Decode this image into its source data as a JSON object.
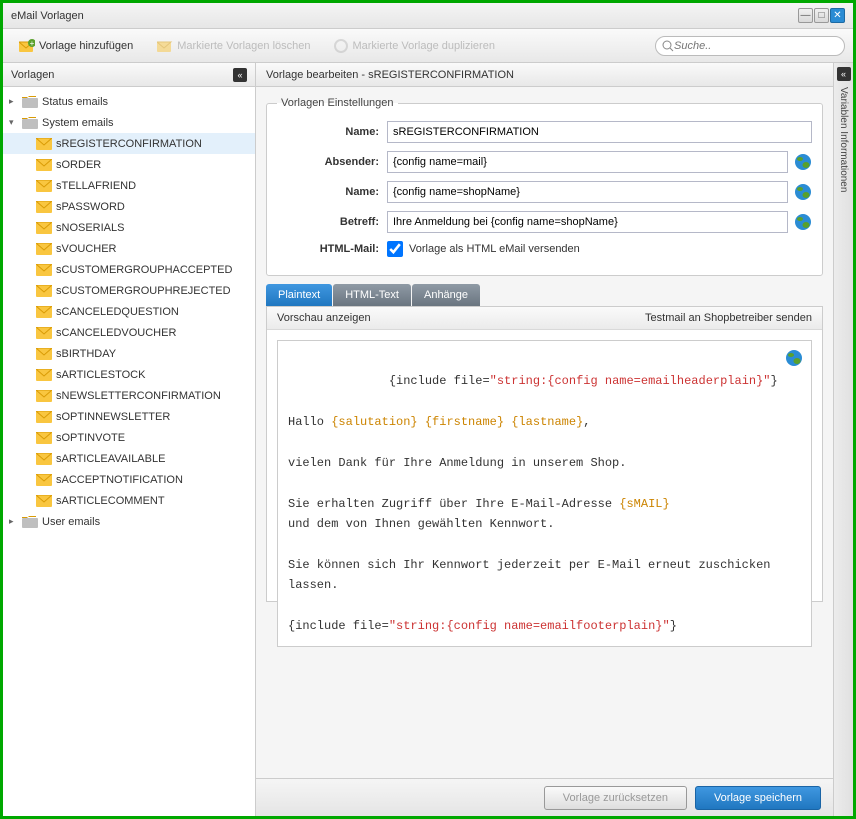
{
  "window": {
    "title": "eMail Vorlagen"
  },
  "toolbar": {
    "add": "Vorlage hinzufügen",
    "delete": "Markierte Vorlagen löschen",
    "duplicate": "Markierte Vorlage duplizieren",
    "search_placeholder": "Suche.."
  },
  "sidebar": {
    "title": "Vorlagen",
    "folders": [
      {
        "label": "Status emails",
        "expanded": false
      },
      {
        "label": "System emails",
        "expanded": true,
        "children": [
          "sREGISTERCONFIRMATION",
          "sORDER",
          "sTELLAFRIEND",
          "sPASSWORD",
          "sNOSERIALS",
          "sVOUCHER",
          "sCUSTOMERGROUPHACCEPTED",
          "sCUSTOMERGROUPHREJECTED",
          "sCANCELEDQUESTION",
          "sCANCELEDVOUCHER",
          "sBIRTHDAY",
          "sARTICLESTOCK",
          "sNEWSLETTERCONFIRMATION",
          "sOPTINNEWSLETTER",
          "sOPTINVOTE",
          "sARTICLEAVAILABLE",
          "sACCEPTNOTIFICATION",
          "sARTICLECOMMENT"
        ]
      },
      {
        "label": "User emails",
        "expanded": false
      }
    ],
    "selected": "sREGISTERCONFIRMATION"
  },
  "main": {
    "header": "Vorlage bearbeiten - sREGISTERCONFIRMATION",
    "legend": "Vorlagen Einstellungen",
    "labels": {
      "name1": "Name:",
      "sender": "Absender:",
      "name2": "Name:",
      "subject": "Betreff:",
      "htmlmail": "HTML-Mail:"
    },
    "values": {
      "name1": "sREGISTERCONFIRMATION",
      "sender": "{config name=mail}",
      "name2": "{config name=shopName}",
      "subject": "Ihre Anmeldung bei {config name=shopName}",
      "html_hint": "Vorlage als HTML eMail versenden"
    },
    "tabs": [
      "Plaintext",
      "HTML-Text",
      "Anhänge"
    ],
    "active_tab": 0,
    "pane": {
      "preview": "Vorschau anzeigen",
      "testmail": "Testmail an Shopbetreiber senden"
    }
  },
  "rightPanel": {
    "title": "Variablen Informationen"
  },
  "footer": {
    "reset": "Vorlage zurücksetzen",
    "save": "Vorlage speichern"
  }
}
